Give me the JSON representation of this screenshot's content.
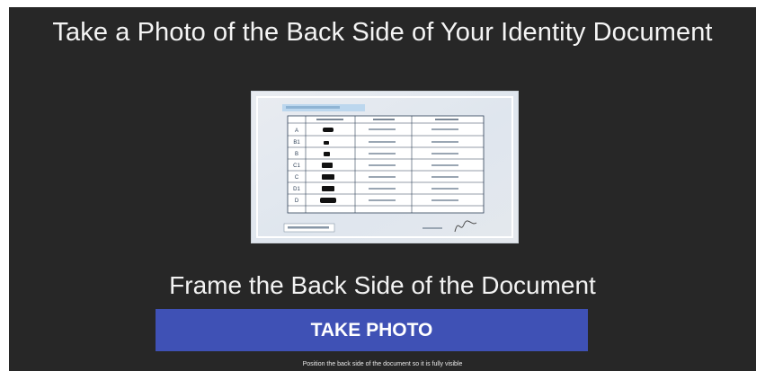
{
  "page": {
    "title": "Take a Photo of the Back Side of Your Identity Document",
    "frame_instruction": "Frame the Back Side of the Document",
    "take_photo_label": "TAKE PHOTO",
    "hint": "Position the back side of the document so it is fully visible"
  },
  "document_preview": {
    "icon": "id-card-back-illustration",
    "categories": [
      "A",
      "B1",
      "B",
      "C1",
      "C",
      "D1",
      "D"
    ]
  },
  "colors": {
    "background": "#272727",
    "accent": "#3f51b5",
    "text": "#f4f4f4"
  }
}
